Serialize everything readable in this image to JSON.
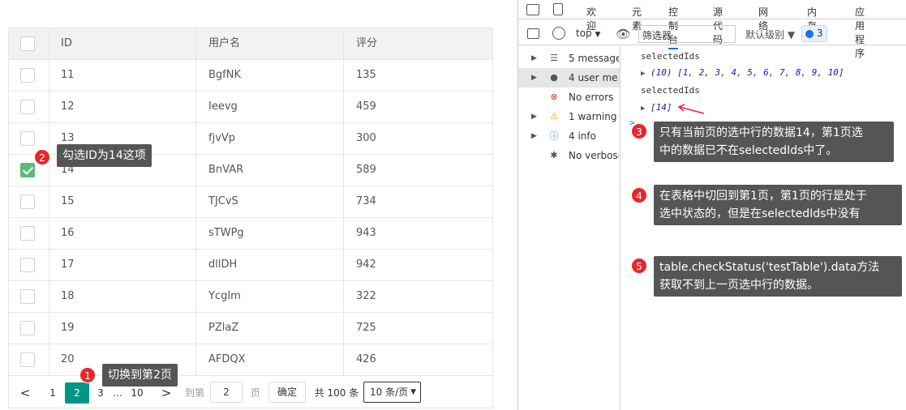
{
  "table": {
    "headers": {
      "id": "ID",
      "username": "用户名",
      "score": "评分"
    },
    "rows": [
      {
        "id": "11",
        "username": "BgfNK",
        "score": "135",
        "checked": false
      },
      {
        "id": "12",
        "username": "Ieevg",
        "score": "459",
        "checked": false
      },
      {
        "id": "13",
        "username": "fjvVp",
        "score": "300",
        "checked": false
      },
      {
        "id": "14",
        "username": "BnVAR",
        "score": "589",
        "checked": true
      },
      {
        "id": "15",
        "username": "TJCvS",
        "score": "734",
        "checked": false
      },
      {
        "id": "16",
        "username": "sTWPg",
        "score": "943",
        "checked": false
      },
      {
        "id": "17",
        "username": "dllDH",
        "score": "942",
        "checked": false
      },
      {
        "id": "18",
        "username": "YcgIm",
        "score": "322",
        "checked": false
      },
      {
        "id": "19",
        "username": "PZlaZ",
        "score": "725",
        "checked": false
      },
      {
        "id": "20",
        "username": "AFDQX",
        "score": "426",
        "checked": false
      }
    ]
  },
  "pager": {
    "prev": "<",
    "p1": "1",
    "p2": "2",
    "p3": "3",
    "ellipsis": "…",
    "p10": "10",
    "next": ">",
    "goto_label": "到第",
    "goto_value": "2",
    "page_label": "页",
    "ok": "确定",
    "total": "共 100 条",
    "per_page": "10 条/页"
  },
  "devtools": {
    "tabs": [
      "欢迎",
      "元素",
      "控制台",
      "源代码",
      "网络",
      "内存",
      "应用程序"
    ],
    "active_tab": "控制台",
    "context": "top",
    "filter_placeholder": "筛选器",
    "level": "默认级别 ▼",
    "issues_count": "3",
    "sidebar": [
      {
        "label": "5 messages",
        "icon": "☰"
      },
      {
        "label": "4 user me...",
        "icon": "●"
      },
      {
        "label": "No errors",
        "icon": "⊗"
      },
      {
        "label": "1 warning",
        "icon": "⚠"
      },
      {
        "label": "4 info",
        "icon": "ⓘ"
      },
      {
        "label": "No verbose",
        "icon": "✱"
      }
    ],
    "console": {
      "line1": "selectedIds",
      "line2": "(10) [1, 2, 3, 4, 5, 6, 7, 8, 9, 10]",
      "line3": "selectedIds",
      "line4": "[14]",
      "prompt": ">"
    }
  },
  "callouts": [
    {
      "n": "1",
      "text": "切换到第2页"
    },
    {
      "n": "2",
      "text": "勾选ID为14这项"
    },
    {
      "n": "3",
      "text": "只有当前页的选中行的数据14，第1页选\n中的数据已不在selectedIds中了。"
    },
    {
      "n": "4",
      "text": "在表格中切回到第1页，第1页的行是处于\n选中状态的，但是在selectedIds中没有"
    },
    {
      "n": "5",
      "text": "table.checkStatus('testTable').data方法\n获取不到上一页选中行的数据。"
    }
  ],
  "colors": {
    "checked": "#5fb878",
    "pager_current": "#009688",
    "badge": "#e8262b",
    "callout_bg": "#555555"
  }
}
